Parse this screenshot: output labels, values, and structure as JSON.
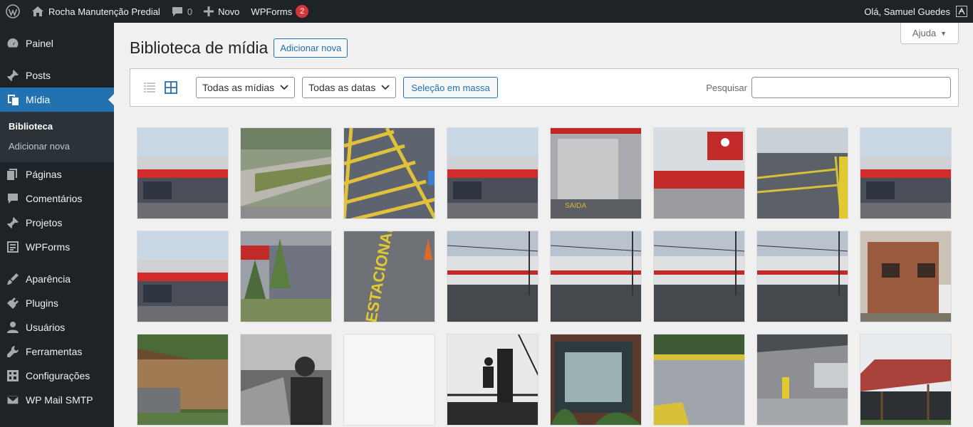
{
  "adminbar": {
    "site_name": "Rocha Manutenção Predial",
    "comments_count": "0",
    "new_label": "Novo",
    "wpforms_label": "WPForms",
    "wpforms_badge": "2",
    "greeting": "Olá, Samuel Guedes"
  },
  "sidebar": {
    "items": [
      {
        "label": "Painel",
        "icon": "dashboard-icon"
      },
      {
        "label": "Posts",
        "icon": "pin-icon"
      },
      {
        "label": "Mídia",
        "icon": "media-icon"
      },
      {
        "label": "Páginas",
        "icon": "pages-icon"
      },
      {
        "label": "Comentários",
        "icon": "comments-icon"
      },
      {
        "label": "Projetos",
        "icon": "pin-icon"
      },
      {
        "label": "WPForms",
        "icon": "forms-icon"
      },
      {
        "label": "Aparência",
        "icon": "appearance-icon"
      },
      {
        "label": "Plugins",
        "icon": "plugins-icon"
      },
      {
        "label": "Usuários",
        "icon": "users-icon"
      },
      {
        "label": "Ferramentas",
        "icon": "tools-icon"
      },
      {
        "label": "Configurações",
        "icon": "settings-icon"
      },
      {
        "label": "WP Mail SMTP",
        "icon": "mail-icon"
      }
    ],
    "submenu": [
      "Biblioteca",
      "Adicionar nova"
    ]
  },
  "help_label": "Ajuda",
  "page": {
    "title": "Biblioteca de mídia",
    "add_new_label": "Adicionar nova"
  },
  "toolbar": {
    "filter_media": "Todas as mídias",
    "filter_dates": "Todas as datas",
    "bulk_select": "Seleção em massa",
    "search_label": "Pesquisar"
  },
  "colors": {
    "accent": "#2271b1",
    "adminbar_bg": "#1d2327",
    "badge": "#d63638"
  },
  "media_tiles": [
    "building-red-stripe",
    "parking-curb",
    "yellow-lines",
    "building-red-stripe",
    "warehouse-door",
    "bradesco-sign",
    "parking-lot",
    "building-red-stripe",
    "building-red-stripe",
    "garden-wall",
    "estacionamento-paint",
    "street-building",
    "street-building",
    "street-building",
    "street-building",
    "brick-barbecue",
    "wooden-shed",
    "worker-portrait-bw",
    "blank",
    "silhouette-worker",
    "glass-entrance",
    "courtyard-floor",
    "covered-parking",
    "tile-roof-shelter"
  ]
}
